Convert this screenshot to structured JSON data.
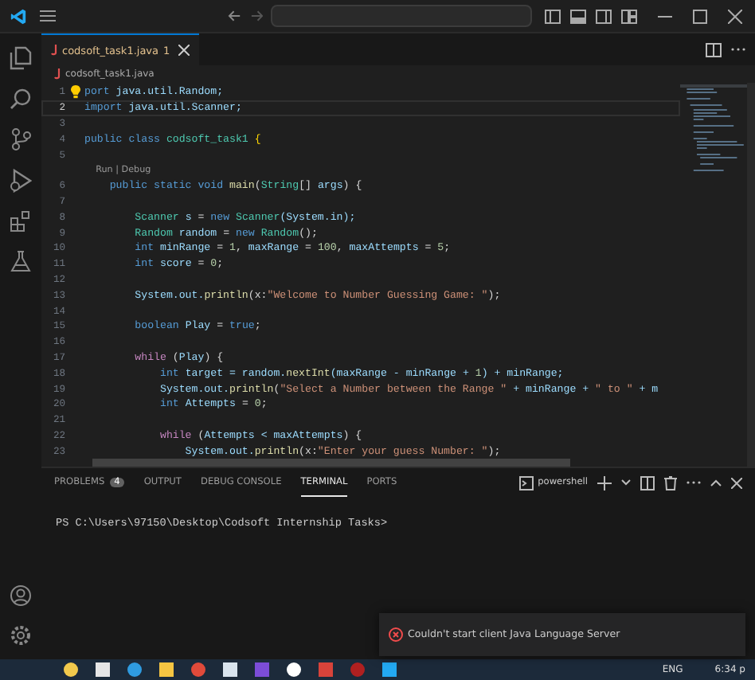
{
  "editor_tab": {
    "label": "codsoft_task1.java",
    "problems": "1",
    "selected": true
  },
  "breadcrumb": "codsoft_task1.java",
  "lines": [
    {
      "kind": "code",
      "number": "1",
      "lightbulb": true,
      "current": false,
      "tokens": [
        {
          "t": "port",
          "kind": "kw"
        },
        {
          "t": " java.util.Random;",
          "kind": "var"
        }
      ]
    },
    {
      "kind": "code",
      "number": "2",
      "lightbulb": false,
      "current": true,
      "tokens": [
        {
          "t": "import",
          "kind": "kw"
        },
        {
          "t": " java.util.Scanner;",
          "kind": "var"
        }
      ]
    },
    {
      "kind": "code",
      "number": "3",
      "lightbulb": false,
      "current": false
    },
    {
      "kind": "code",
      "number": "4",
      "lightbulb": false,
      "current": false,
      "tokens": [
        {
          "t": "public class",
          "kind": "kw"
        },
        {
          "t": " codsoft_task1 ",
          "kind": "type"
        },
        {
          "t": "{",
          "kind": "brace"
        }
      ]
    },
    {
      "kind": "code",
      "number": "5",
      "lightbulb": false,
      "current": false
    },
    {
      "kind": "codelens",
      "text": "Run | Debug"
    },
    {
      "kind": "code",
      "number": "6",
      "lightbulb": false,
      "current": false,
      "tokens": [
        {
          "t": "    public static void",
          "kind": "kw"
        },
        {
          "t": " main",
          "kind": "fn"
        },
        {
          "t": "(",
          "kind": "plain"
        },
        {
          "t": "String",
          "kind": "type"
        },
        {
          "t": "[] ",
          "kind": "plain"
        },
        {
          "t": "args",
          "kind": "var"
        },
        {
          "t": ") {",
          "kind": "plain"
        }
      ]
    },
    {
      "kind": "code",
      "number": "7",
      "lightbulb": false,
      "current": false
    },
    {
      "kind": "code",
      "number": "8",
      "lightbulb": false,
      "current": false,
      "tokens": [
        {
          "t": "        Scanner",
          "kind": "type"
        },
        {
          "t": " s ",
          "kind": "var"
        },
        {
          "t": "= ",
          "kind": "plain"
        },
        {
          "t": "new",
          "kind": "kw"
        },
        {
          "t": " Scanner",
          "kind": "type"
        },
        {
          "t": "(System.in);",
          "kind": "var"
        }
      ]
    },
    {
      "kind": "code",
      "number": "9",
      "lightbulb": false,
      "current": false,
      "tokens": [
        {
          "t": "        Random",
          "kind": "type"
        },
        {
          "t": " random ",
          "kind": "var"
        },
        {
          "t": "= ",
          "kind": "plain"
        },
        {
          "t": "new",
          "kind": "kw"
        },
        {
          "t": " Random",
          "kind": "type"
        },
        {
          "t": "();",
          "kind": "plain"
        }
      ]
    },
    {
      "kind": "code",
      "number": "10",
      "lightbulb": false,
      "current": false,
      "tokens": [
        {
          "t": "        int",
          "kind": "kw"
        },
        {
          "t": " minRange ",
          "kind": "var"
        },
        {
          "t": "= ",
          "kind": "plain"
        },
        {
          "t": "1",
          "kind": "num"
        },
        {
          "t": ", ",
          "kind": "plain"
        },
        {
          "t": "maxRange ",
          "kind": "var"
        },
        {
          "t": "= ",
          "kind": "plain"
        },
        {
          "t": "100",
          "kind": "num"
        },
        {
          "t": ", ",
          "kind": "plain"
        },
        {
          "t": "maxAttempts ",
          "kind": "var"
        },
        {
          "t": "= ",
          "kind": "plain"
        },
        {
          "t": "5",
          "kind": "num"
        },
        {
          "t": ";",
          "kind": "plain"
        }
      ]
    },
    {
      "kind": "code",
      "number": "11",
      "lightbulb": false,
      "current": false,
      "tokens": [
        {
          "t": "        int",
          "kind": "kw"
        },
        {
          "t": " score ",
          "kind": "var"
        },
        {
          "t": "= ",
          "kind": "plain"
        },
        {
          "t": "0",
          "kind": "num"
        },
        {
          "t": ";",
          "kind": "plain"
        }
      ]
    },
    {
      "kind": "code",
      "number": "12",
      "lightbulb": false,
      "current": false
    },
    {
      "kind": "code",
      "number": "13",
      "lightbulb": false,
      "current": false,
      "tokens": [
        {
          "t": "        System.out.",
          "kind": "var"
        },
        {
          "t": "println",
          "kind": "fn"
        },
        {
          "t": "(x:",
          "kind": "plain"
        },
        {
          "t": "\"Welcome to Number Guessing Game: \"",
          "kind": "str"
        },
        {
          "t": ");",
          "kind": "plain"
        }
      ]
    },
    {
      "kind": "code",
      "number": "14",
      "lightbulb": false,
      "current": false
    },
    {
      "kind": "code",
      "number": "15",
      "lightbulb": false,
      "current": false,
      "tokens": [
        {
          "t": "        boolean",
          "kind": "kw"
        },
        {
          "t": " Play ",
          "kind": "var"
        },
        {
          "t": "= ",
          "kind": "plain"
        },
        {
          "t": "true",
          "kind": "kw"
        },
        {
          "t": ";",
          "kind": "plain"
        }
      ]
    },
    {
      "kind": "code",
      "number": "16",
      "lightbulb": false,
      "current": false
    },
    {
      "kind": "code",
      "number": "17",
      "lightbulb": false,
      "current": false,
      "tokens": [
        {
          "t": "        while",
          "kind": "ctl"
        },
        {
          "t": " (",
          "kind": "plain"
        },
        {
          "t": "Play",
          "kind": "var"
        },
        {
          "t": ") {",
          "kind": "plain"
        }
      ]
    },
    {
      "kind": "code",
      "number": "18",
      "lightbulb": false,
      "current": false,
      "tokens": [
        {
          "t": "            int",
          "kind": "kw"
        },
        {
          "t": " target ",
          "kind": "var"
        },
        {
          "t": "= random.",
          "kind": "var"
        },
        {
          "t": "nextInt",
          "kind": "fn"
        },
        {
          "t": "(maxRange - minRange + ",
          "kind": "var"
        },
        {
          "t": "1",
          "kind": "num"
        },
        {
          "t": ") + minRange;",
          "kind": "var"
        }
      ]
    },
    {
      "kind": "code",
      "number": "19",
      "lightbulb": false,
      "current": false,
      "tokens": [
        {
          "t": "            System.out.",
          "kind": "var"
        },
        {
          "t": "println",
          "kind": "fn"
        },
        {
          "t": "(",
          "kind": "plain"
        },
        {
          "t": "\"Select a Number between the Range \"",
          "kind": "str"
        },
        {
          "t": " + minRange + ",
          "kind": "var"
        },
        {
          "t": "\" to \"",
          "kind": "str"
        },
        {
          "t": " + m",
          "kind": "var"
        }
      ]
    },
    {
      "kind": "code",
      "number": "20",
      "lightbulb": false,
      "current": false,
      "tokens": [
        {
          "t": "            int",
          "kind": "kw"
        },
        {
          "t": " Attempts ",
          "kind": "var"
        },
        {
          "t": "= ",
          "kind": "plain"
        },
        {
          "t": "0",
          "kind": "num"
        },
        {
          "t": ";",
          "kind": "plain"
        }
      ]
    },
    {
      "kind": "code",
      "number": "21",
      "lightbulb": false,
      "current": false
    },
    {
      "kind": "code",
      "number": "22",
      "lightbulb": false,
      "current": false,
      "tokens": [
        {
          "t": "            while",
          "kind": "ctl"
        },
        {
          "t": " (",
          "kind": "plain"
        },
        {
          "t": "Attempts < maxAttempts",
          "kind": "var"
        },
        {
          "t": ") {",
          "kind": "plain"
        }
      ]
    },
    {
      "kind": "code",
      "number": "23",
      "lightbulb": false,
      "current": false,
      "tokens": [
        {
          "t": "                System.out.",
          "kind": "var"
        },
        {
          "t": "println",
          "kind": "fn"
        },
        {
          "t": "(x:",
          "kind": "plain"
        },
        {
          "t": "\"Enter your guess Number: \"",
          "kind": "str"
        },
        {
          "t": ");",
          "kind": "plain"
        }
      ]
    }
  ],
  "panel_tabs": [
    {
      "label": "PROBLEMS",
      "badge": "4",
      "selected": false
    },
    {
      "label": "OUTPUT",
      "selected": false
    },
    {
      "label": "DEBUG CONSOLE",
      "selected": false
    },
    {
      "label": "TERMINAL",
      "selected": true
    },
    {
      "label": "PORTS",
      "selected": false
    }
  ],
  "terminal_profile": "powershell",
  "terminal_prompt": "PS C:\\Users\\97150\\Desktop\\Codsoft Internship Tasks>",
  "notification": "Couldn't start client Java Language Server",
  "taskbar": {
    "language": "ENG",
    "time": "6:34 p"
  }
}
